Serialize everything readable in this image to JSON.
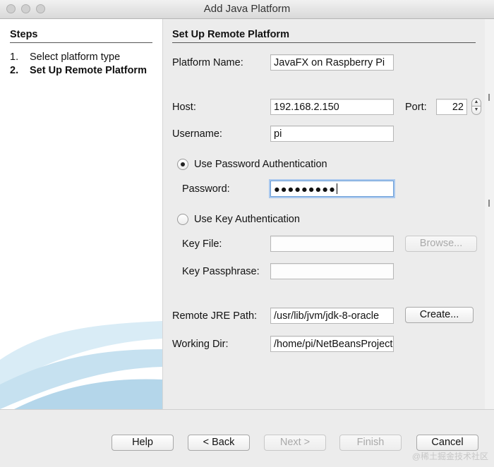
{
  "window": {
    "title": "Add Java Platform"
  },
  "steps": {
    "heading": "Steps",
    "items": [
      {
        "num": "1.",
        "label": "Select platform type",
        "active": false
      },
      {
        "num": "2.",
        "label": "Set Up Remote Platform",
        "active": true
      }
    ]
  },
  "form": {
    "section_title": "Set Up Remote Platform",
    "platform_name_label": "Platform Name:",
    "platform_name_value": "JavaFX on Raspberry Pi",
    "host_label": "Host:",
    "host_value": "192.168.2.150",
    "port_label": "Port:",
    "port_value": "22",
    "username_label": "Username:",
    "username_value": "pi",
    "auth_password_label": "Use Password Authentication",
    "auth_password_selected": true,
    "password_label": "Password:",
    "password_value": "●●●●●●●●●",
    "auth_key_label": "Use Key Authentication",
    "auth_key_selected": false,
    "key_file_label": "Key File:",
    "key_file_value": "",
    "browse_label": "Browse...",
    "key_passphrase_label": "Key Passphrase:",
    "key_passphrase_value": "",
    "jre_path_label": "Remote JRE Path:",
    "jre_path_value": "/usr/lib/jvm/jdk-8-oracle",
    "create_label": "Create...",
    "working_dir_label": "Working Dir:",
    "working_dir_value": "/home/pi/NetBeansProjects"
  },
  "buttons": {
    "help": "Help",
    "back": "< Back",
    "next": "Next >",
    "finish": "Finish",
    "cancel": "Cancel"
  },
  "watermark": "@稀土掘金技术社区"
}
